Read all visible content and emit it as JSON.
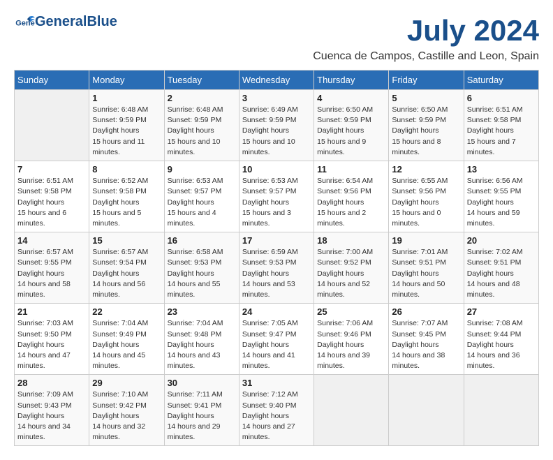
{
  "app": {
    "name": "GeneralBlue",
    "title": "July 2024",
    "location": "Cuenca de Campos, Castille and Leon, Spain"
  },
  "calendar": {
    "headers": [
      "Sunday",
      "Monday",
      "Tuesday",
      "Wednesday",
      "Thursday",
      "Friday",
      "Saturday"
    ],
    "weeks": [
      [
        {
          "day": "",
          "sunrise": "",
          "sunset": "",
          "daylight": ""
        },
        {
          "day": "1",
          "sunrise": "6:48 AM",
          "sunset": "9:59 PM",
          "daylight": "15 hours and 11 minutes."
        },
        {
          "day": "2",
          "sunrise": "6:48 AM",
          "sunset": "9:59 PM",
          "daylight": "15 hours and 10 minutes."
        },
        {
          "day": "3",
          "sunrise": "6:49 AM",
          "sunset": "9:59 PM",
          "daylight": "15 hours and 10 minutes."
        },
        {
          "day": "4",
          "sunrise": "6:50 AM",
          "sunset": "9:59 PM",
          "daylight": "15 hours and 9 minutes."
        },
        {
          "day": "5",
          "sunrise": "6:50 AM",
          "sunset": "9:59 PM",
          "daylight": "15 hours and 8 minutes."
        },
        {
          "day": "6",
          "sunrise": "6:51 AM",
          "sunset": "9:58 PM",
          "daylight": "15 hours and 7 minutes."
        }
      ],
      [
        {
          "day": "7",
          "sunrise": "6:51 AM",
          "sunset": "9:58 PM",
          "daylight": "15 hours and 6 minutes."
        },
        {
          "day": "8",
          "sunrise": "6:52 AM",
          "sunset": "9:58 PM",
          "daylight": "15 hours and 5 minutes."
        },
        {
          "day": "9",
          "sunrise": "6:53 AM",
          "sunset": "9:57 PM",
          "daylight": "15 hours and 4 minutes."
        },
        {
          "day": "10",
          "sunrise": "6:53 AM",
          "sunset": "9:57 PM",
          "daylight": "15 hours and 3 minutes."
        },
        {
          "day": "11",
          "sunrise": "6:54 AM",
          "sunset": "9:56 PM",
          "daylight": "15 hours and 2 minutes."
        },
        {
          "day": "12",
          "sunrise": "6:55 AM",
          "sunset": "9:56 PM",
          "daylight": "15 hours and 0 minutes."
        },
        {
          "day": "13",
          "sunrise": "6:56 AM",
          "sunset": "9:55 PM",
          "daylight": "14 hours and 59 minutes."
        }
      ],
      [
        {
          "day": "14",
          "sunrise": "6:57 AM",
          "sunset": "9:55 PM",
          "daylight": "14 hours and 58 minutes."
        },
        {
          "day": "15",
          "sunrise": "6:57 AM",
          "sunset": "9:54 PM",
          "daylight": "14 hours and 56 minutes."
        },
        {
          "day": "16",
          "sunrise": "6:58 AM",
          "sunset": "9:53 PM",
          "daylight": "14 hours and 55 minutes."
        },
        {
          "day": "17",
          "sunrise": "6:59 AM",
          "sunset": "9:53 PM",
          "daylight": "14 hours and 53 minutes."
        },
        {
          "day": "18",
          "sunrise": "7:00 AM",
          "sunset": "9:52 PM",
          "daylight": "14 hours and 52 minutes."
        },
        {
          "day": "19",
          "sunrise": "7:01 AM",
          "sunset": "9:51 PM",
          "daylight": "14 hours and 50 minutes."
        },
        {
          "day": "20",
          "sunrise": "7:02 AM",
          "sunset": "9:51 PM",
          "daylight": "14 hours and 48 minutes."
        }
      ],
      [
        {
          "day": "21",
          "sunrise": "7:03 AM",
          "sunset": "9:50 PM",
          "daylight": "14 hours and 47 minutes."
        },
        {
          "day": "22",
          "sunrise": "7:04 AM",
          "sunset": "9:49 PM",
          "daylight": "14 hours and 45 minutes."
        },
        {
          "day": "23",
          "sunrise": "7:04 AM",
          "sunset": "9:48 PM",
          "daylight": "14 hours and 43 minutes."
        },
        {
          "day": "24",
          "sunrise": "7:05 AM",
          "sunset": "9:47 PM",
          "daylight": "14 hours and 41 minutes."
        },
        {
          "day": "25",
          "sunrise": "7:06 AM",
          "sunset": "9:46 PM",
          "daylight": "14 hours and 39 minutes."
        },
        {
          "day": "26",
          "sunrise": "7:07 AM",
          "sunset": "9:45 PM",
          "daylight": "14 hours and 38 minutes."
        },
        {
          "day": "27",
          "sunrise": "7:08 AM",
          "sunset": "9:44 PM",
          "daylight": "14 hours and 36 minutes."
        }
      ],
      [
        {
          "day": "28",
          "sunrise": "7:09 AM",
          "sunset": "9:43 PM",
          "daylight": "14 hours and 34 minutes."
        },
        {
          "day": "29",
          "sunrise": "7:10 AM",
          "sunset": "9:42 PM",
          "daylight": "14 hours and 32 minutes."
        },
        {
          "day": "30",
          "sunrise": "7:11 AM",
          "sunset": "9:41 PM",
          "daylight": "14 hours and 29 minutes."
        },
        {
          "day": "31",
          "sunrise": "7:12 AM",
          "sunset": "9:40 PM",
          "daylight": "14 hours and 27 minutes."
        },
        {
          "day": "",
          "sunrise": "",
          "sunset": "",
          "daylight": ""
        },
        {
          "day": "",
          "sunrise": "",
          "sunset": "",
          "daylight": ""
        },
        {
          "day": "",
          "sunrise": "",
          "sunset": "",
          "daylight": ""
        }
      ]
    ]
  }
}
